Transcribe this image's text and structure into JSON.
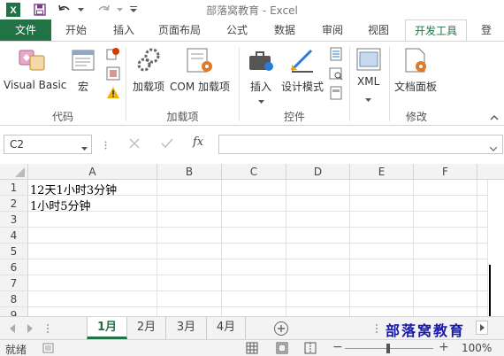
{
  "title": "部落窝教育 - Excel",
  "tabs": [
    "文件",
    "开始",
    "插入",
    "页面布局",
    "公式",
    "数据",
    "审阅",
    "视图",
    "开发工具",
    "登"
  ],
  "active_tab": "开发工具",
  "ribbon": {
    "groups": [
      {
        "label": "代码",
        "buttons": [
          "Visual Basic",
          "宏"
        ]
      },
      {
        "label": "加载项",
        "buttons": [
          "加载项",
          "COM 加载项"
        ]
      },
      {
        "label": "控件",
        "buttons": [
          "插入",
          "设计模式"
        ]
      },
      {
        "label": "",
        "buttons": [
          "XML"
        ]
      },
      {
        "label": "修改",
        "buttons": [
          "文档面板"
        ]
      }
    ]
  },
  "formula_bar": {
    "name_box": "C2",
    "fx": "fx",
    "formula": ""
  },
  "columns": [
    "A",
    "B",
    "C",
    "D",
    "E",
    "F"
  ],
  "rows": [
    "1",
    "2",
    "3",
    "4",
    "5",
    "6",
    "7",
    "8",
    "9"
  ],
  "cells": {
    "A1": "12天1小时3分钟",
    "A2": "1小时5分钟"
  },
  "sheets": [
    "1月",
    "2月",
    "3月",
    "4月"
  ],
  "active_sheet": "1月",
  "watermark": "部落窝教育",
  "status": {
    "left": "就绪",
    "zoom": "100%"
  },
  "colors": {
    "accent": "#217346",
    "watermark": "#1a1aa8"
  }
}
